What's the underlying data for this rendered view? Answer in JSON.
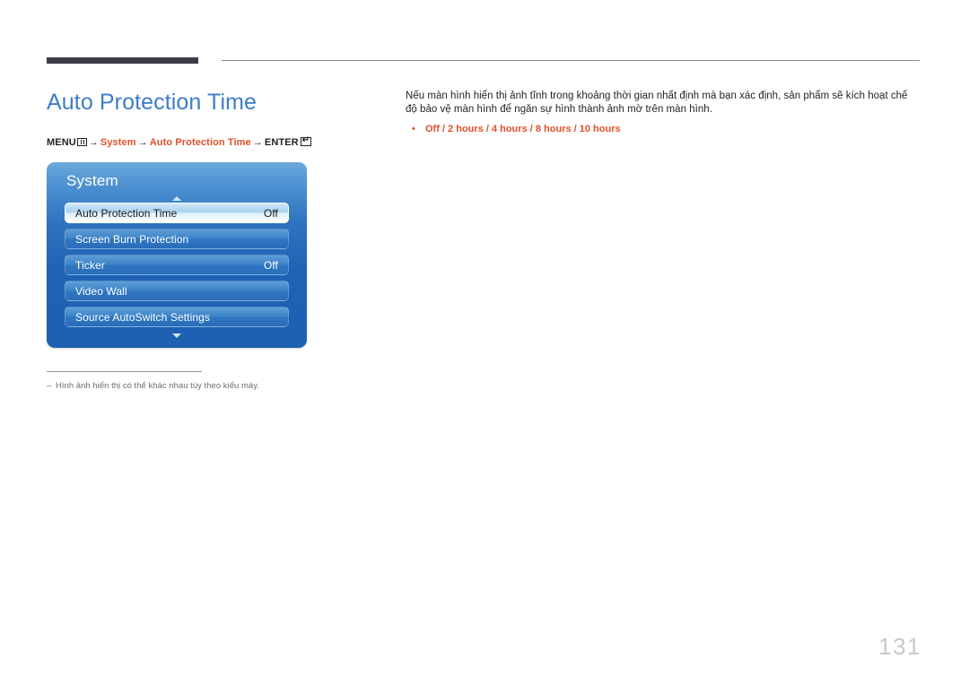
{
  "page": {
    "title": "Auto Protection Time",
    "number": "131"
  },
  "breadcrumb": {
    "menu_label": "MENU",
    "menu_icon": "menu-grid-icon",
    "arrow": "→",
    "step_system": "System",
    "step_feature": "Auto Protection Time",
    "enter_label": "ENTER",
    "enter_icon": "enter-key-icon"
  },
  "osd": {
    "panel_title": "System",
    "scroll_up_icon": "chevron-up-icon",
    "scroll_down_icon": "chevron-down-icon",
    "rows": [
      {
        "label": "Auto Protection Time",
        "value": "Off",
        "selected": true
      },
      {
        "label": "Screen Burn Protection",
        "value": "",
        "selected": false
      },
      {
        "label": "Ticker",
        "value": "Off",
        "selected": false
      },
      {
        "label": "Video Wall",
        "value": "",
        "selected": false
      },
      {
        "label": "Source AutoSwitch Settings",
        "value": "",
        "selected": false
      }
    ]
  },
  "body": {
    "paragraph": "Nếu màn hình hiển thị ảnh tĩnh trong khoảng thời gian nhất định mà bạn xác định, sản phẩm sẽ kích hoạt chế độ bảo vệ màn hình để ngăn sự hình thành ảnh mờ trên màn hình.",
    "bullet_marker": "•",
    "options": "Off / 2 hours / 4 hours / 8 hours / 10 hours"
  },
  "footnote": {
    "dash": "‒",
    "text": "Hình ảnh hiển thị có thể khác nhau tùy theo kiểu máy."
  },
  "colors": {
    "title_blue": "#3d7cc9",
    "accent_orange": "#e1502a",
    "rule_dark": "#3d3b4a",
    "osd_blue": "#1f63b4",
    "page_number_gray": "#c7c9cf"
  }
}
